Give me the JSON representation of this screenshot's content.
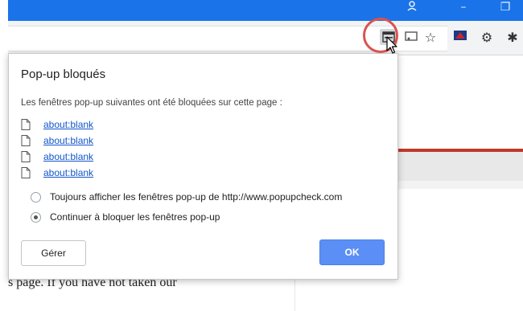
{
  "window": {
    "minimize_glyph": "–",
    "restore_glyph": "❐",
    "account_icon": "account-icon"
  },
  "toolbar": {
    "icons": [
      "popup-blocked-icon",
      "cast-icon",
      "star-icon",
      "extension-icon",
      "settings-icon",
      "bug-extension-icon"
    ],
    "star_glyph": "☆",
    "settings_glyph": "⚙",
    "bug_glyph": "✱"
  },
  "dialog": {
    "title": "Pop-up bloqués",
    "description": "Les fenêtres pop-up suivantes ont été bloquées sur cette page :",
    "links": [
      "about:blank",
      "about:blank",
      "about:blank",
      "about:blank"
    ],
    "options": [
      {
        "label": "Toujours afficher les fenêtres pop-up de http://www.popupcheck.com",
        "checked": false
      },
      {
        "label": "Continuer à bloquer les fenêtres pop-up",
        "checked": true
      }
    ],
    "manage_label": "Gérer",
    "ok_label": "OK"
  },
  "page": {
    "text": "s page. If you have not taken our"
  },
  "colors": {
    "titlebar": "#1a73e8",
    "highlight": "#d9534f",
    "ok_button": "#5b8ff5",
    "link": "#1155cc",
    "accent_line": "#c0392b"
  }
}
